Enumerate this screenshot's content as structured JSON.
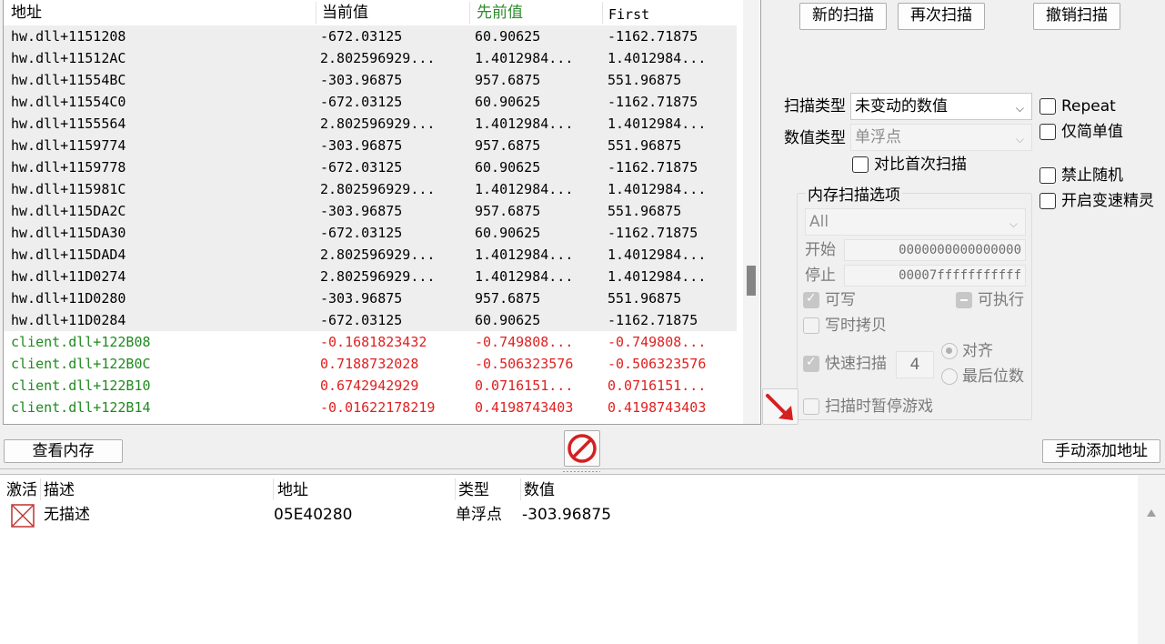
{
  "results": {
    "headers": [
      "地址",
      "当前值",
      "先前值",
      "First"
    ],
    "header_colors": {
      "previous": "#2e8b2e"
    },
    "rows": [
      {
        "address": "hw.dll+1151208",
        "current": "-672.03125",
        "previous": "60.90625",
        "first": "-1162.71875",
        "style": "sel"
      },
      {
        "address": "hw.dll+11512AC",
        "current": "2.802596929...",
        "previous": "1.4012984...",
        "first": "1.4012984...",
        "style": "sel"
      },
      {
        "address": "hw.dll+11554BC",
        "current": "-303.96875",
        "previous": "957.6875",
        "first": "551.96875",
        "style": "sel"
      },
      {
        "address": "hw.dll+11554C0",
        "current": "-672.03125",
        "previous": "60.90625",
        "first": "-1162.71875",
        "style": "sel"
      },
      {
        "address": "hw.dll+1155564",
        "current": "2.802596929...",
        "previous": "1.4012984...",
        "first": "1.4012984...",
        "style": "sel"
      },
      {
        "address": "hw.dll+1159774",
        "current": "-303.96875",
        "previous": "957.6875",
        "first": "551.96875",
        "style": "sel"
      },
      {
        "address": "hw.dll+1159778",
        "current": "-672.03125",
        "previous": "60.90625",
        "first": "-1162.71875",
        "style": "sel"
      },
      {
        "address": "hw.dll+115981C",
        "current": "2.802596929...",
        "previous": "1.4012984...",
        "first": "1.4012984...",
        "style": "sel"
      },
      {
        "address": "hw.dll+115DA2C",
        "current": "-303.96875",
        "previous": "957.6875",
        "first": "551.96875",
        "style": "sel"
      },
      {
        "address": "hw.dll+115DA30",
        "current": "-672.03125",
        "previous": "60.90625",
        "first": "-1162.71875",
        "style": "sel"
      },
      {
        "address": "hw.dll+115DAD4",
        "current": "2.802596929...",
        "previous": "1.4012984...",
        "first": "1.4012984...",
        "style": "sel"
      },
      {
        "address": "hw.dll+11D0274",
        "current": "2.802596929...",
        "previous": "1.4012984...",
        "first": "1.4012984...",
        "style": "sel"
      },
      {
        "address": "hw.dll+11D0280",
        "current": "-303.96875",
        "previous": "957.6875",
        "first": "551.96875",
        "style": "sel"
      },
      {
        "address": "hw.dll+11D0284",
        "current": "-672.03125",
        "previous": "60.90625",
        "first": "-1162.71875",
        "style": "sel"
      },
      {
        "address": "client.dll+122B08",
        "current": "-0.1681823432",
        "previous": "-0.749808...",
        "first": "-0.749808...",
        "style": "green"
      },
      {
        "address": "client.dll+122B0C",
        "current": "0.7188732028",
        "previous": "-0.506323576",
        "first": "-0.506323576",
        "style": "green"
      },
      {
        "address": "client.dll+122B10",
        "current": "0.6742942929",
        "previous": "0.0716151...",
        "first": "0.0716151...",
        "style": "green"
      },
      {
        "address": "client.dll+122B14",
        "current": "-0.01622178219",
        "previous": "0.4198743403",
        "first": "0.4198743403",
        "style": "green"
      }
    ]
  },
  "scan_buttons": {
    "new_scan": "新的扫描",
    "next_scan": "再次扫描",
    "undo_scan": "撤销扫描"
  },
  "scan_options": {
    "scan_type_label": "扫描类型",
    "scan_type_value": "未变动的数值",
    "value_type_label": "数值类型",
    "value_type_value": "单浮点",
    "compare_first_label": "对比首次扫描",
    "repeat_label": "Repeat",
    "simple_values_label": "仅简单值",
    "disable_random_label": "禁止随机",
    "speedhack_label": "开启变速精灵"
  },
  "memory_options": {
    "title": "内存扫描选项",
    "region_value": "All",
    "start_label": "开始",
    "start_value": "0000000000000000",
    "stop_label": "停止",
    "stop_value": "00007fffffffffff",
    "writable_label": "可写",
    "executable_label": "可执行",
    "copy_on_write_label": "写时拷贝",
    "fast_scan_label": "快速扫描",
    "fast_scan_value": "4",
    "alignment_label": "对齐",
    "last_digits_label": "最后位数",
    "pause_game_label": "扫描时暂停游戏"
  },
  "bottom_buttons": {
    "view_memory": "查看内存",
    "add_address": "手动添加地址"
  },
  "address_list": {
    "headers": [
      "激活",
      "描述",
      "地址",
      "类型",
      "数值"
    ],
    "rows": [
      {
        "active": false,
        "description": "无描述",
        "address": "05E40280",
        "type": "单浮点",
        "value": "-303.96875"
      }
    ]
  },
  "icons": {
    "stop": "no-entry-icon",
    "arrow": "red-arrow-down-right-icon",
    "inactive_box": "crossed-checkbox-icon"
  },
  "colors": {
    "green_address": "#1f8a1f",
    "red_value": "#e02020",
    "selection": "#eeeeee"
  }
}
